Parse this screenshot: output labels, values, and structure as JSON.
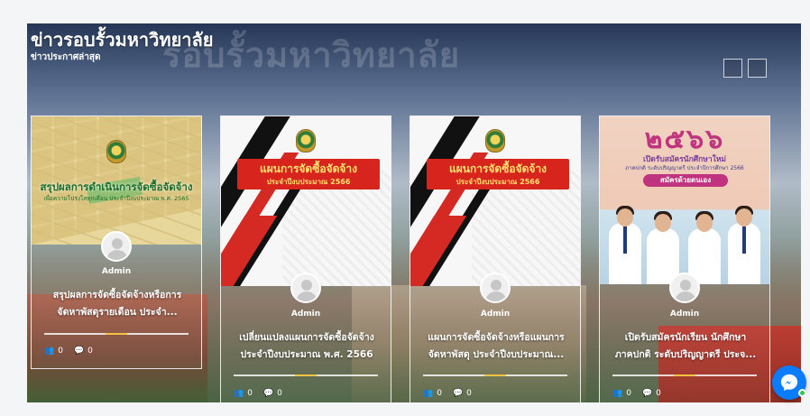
{
  "section": {
    "title": "ข่าวรอบรั้วมหาวิทยาลัย",
    "subtitle": "ข่าวประกาศล่าสุด",
    "watermark": "รอบรั้วมหาวิทยาลัย"
  },
  "cards": [
    {
      "image_line1": "สรุปผลการดำเนินการจัดซื้อจัดจ้าง",
      "image_line2": "เพื่อความโปร่งใสทุกเดือน ประจำปีงบประมาณ พ.ศ. 2565",
      "author": "Admin",
      "title_line1": "สรุปผลการจัดซื้อจัดจ้างหรือการ",
      "title_line2": "จัดหาพัสดุรายเดือน ประจำ...",
      "views": "0",
      "comments": "0"
    },
    {
      "image_line1": "แผนการจัดซื้อจัดจ้าง",
      "image_line2": "ประจำปีงบประมาณ 2566",
      "author": "Admin",
      "title_line1": "เปลี่ยนแปลงแผนการจัดซื้อจัดจ้าง",
      "title_line2": "ประจำปีงบประมาณ พ.ศ. 2566",
      "views": "0",
      "comments": "0"
    },
    {
      "image_line1": "แผนการจัดซื้อจัดจ้าง",
      "image_line2": "ประจำปีงบประมาณ 2566",
      "author": "Admin",
      "title_line1": "แผนการจัดซื้อจัดจ้างหรือแผนการ",
      "title_line2": "จัดหาพัสดุ ประจำปีงบประมาณ...",
      "views": "0",
      "comments": "0"
    },
    {
      "image_year": "๒๕๖๖",
      "image_line1": "เปิดรับสมัครนักศึกษาใหม่",
      "image_line2": "ภาคปกติ ระดับปริญญาตรี ประจำปีการศึกษา 2566",
      "image_cta": "สมัครด้วยตนเอง",
      "author": "Admin",
      "title_line1": "เปิดรับสมัครนักเรียน นักศึกษา",
      "title_line2": "ภาคปกติ ระดับปริญญาตรี ประจ...",
      "views": "0",
      "comments": "0"
    }
  ],
  "icons": {
    "prev": "chevron-left-icon",
    "next": "chevron-right-icon",
    "views": "users-icon",
    "comments": "comment-icon",
    "chat": "messenger-icon"
  },
  "colors": {
    "accent": "#f5c242",
    "banner_red": "#d7241d",
    "messenger": "#0a7cff"
  }
}
